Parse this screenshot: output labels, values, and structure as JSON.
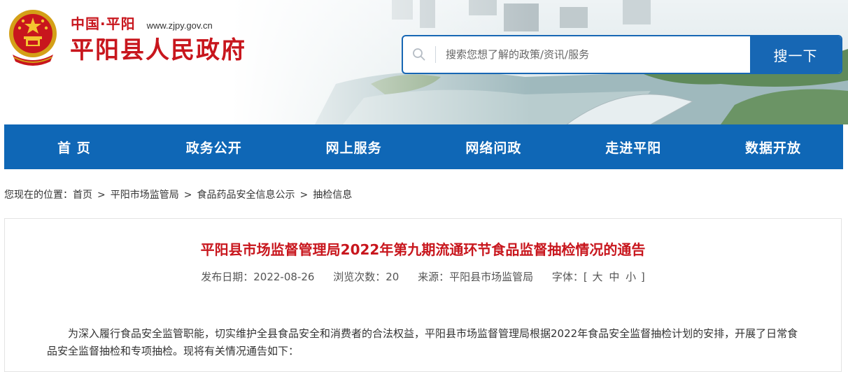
{
  "header": {
    "brand": "中国·平阳",
    "url": "www.zjpy.gov.cn",
    "site_name": "平阳县人民政府"
  },
  "search": {
    "placeholder": "搜索您想了解的政策/资讯/服务",
    "button_label": "搜一下",
    "icon": "search-icon"
  },
  "nav": {
    "items": [
      {
        "label": "首 页"
      },
      {
        "label": "政务公开"
      },
      {
        "label": "网上服务"
      },
      {
        "label": "网络问政"
      },
      {
        "label": "走进平阳"
      },
      {
        "label": "数据开放"
      }
    ]
  },
  "breadcrumb": {
    "prefix": "您现在的位置：",
    "items": [
      "首页",
      "平阳市场监管局",
      "食品药品安全信息公示",
      "抽检信息"
    ],
    "separator": ">"
  },
  "article": {
    "title": "平阳县市场监督管理局2022年第九期流通环节食品监督抽检情况的通告",
    "publish_date": "发布日期：2022-08-26",
    "views": "浏览次数：20",
    "source": "来源：平阳县市场监管局",
    "font_label": "字体：[",
    "font_large": "大",
    "font_medium": "中",
    "font_small": "小",
    "font_close": "]",
    "body": "为深入履行食品安全监管职能，切实维护全县食品安全和消费者的合法权益，平阳县市场监督管理局根据2022年食品安全监督抽检计划的安排，开展了日常食品安全监督抽检和专项抽检。现将有关情况通告如下："
  },
  "colors": {
    "brand_red": "#c8161d",
    "nav_blue": "#0f67b6",
    "search_blue": "#1767b4"
  }
}
